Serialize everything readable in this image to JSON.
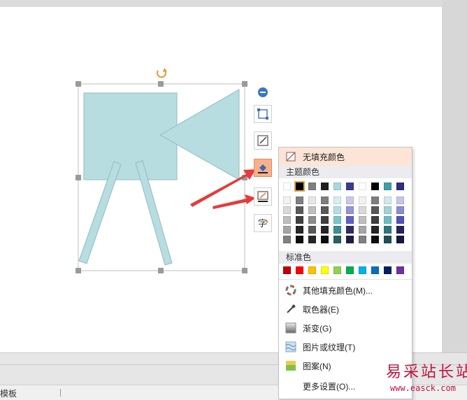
{
  "menu": {
    "no_fill": "无填充颜色",
    "theme_colors_title": "主题颜色",
    "standard_colors_title": "标准色",
    "more_fill_colors": "其他填充颜色(M)...",
    "eyedropper": "取色器(E)",
    "gradient": "渐变(G)",
    "picture_texture": "图片或纹理(T)",
    "pattern": "图案(N)",
    "more_settings": "更多设置(O)..."
  },
  "theme_colors": [
    "#ffffff",
    "#000000",
    "#7f7f7f",
    "#1f1f1f",
    "#a8d8dc",
    "#3b3c8f",
    "#ffffff",
    "#000000",
    "#3f9ea6",
    "#2e2f7e"
  ],
  "theme_shades": [
    [
      "#f2f2f2",
      "#d9d9d9",
      "#bfbfbf",
      "#a6a6a6",
      "#808080"
    ],
    [
      "#7f7f7f",
      "#595959",
      "#3f3f3f",
      "#262626",
      "#0d0d0d"
    ],
    [
      "#e6e6e6",
      "#bfbfbf",
      "#8c8c8c",
      "#595959",
      "#262626"
    ],
    [
      "#7f7f7f",
      "#595959",
      "#404040",
      "#262626",
      "#0d0d0d"
    ],
    [
      "#d6eef0",
      "#b3dfe3",
      "#7cc6cd",
      "#3e8f96",
      "#285f64"
    ],
    [
      "#c9c9ec",
      "#9596d8",
      "#5f61c4",
      "#2c2d6b",
      "#1d1e47"
    ],
    [
      "#f2f2f2",
      "#d9d9d9",
      "#bfbfbf",
      "#a6a6a6",
      "#808080"
    ],
    [
      "#7f7f7f",
      "#595959",
      "#3f3f3f",
      "#262626",
      "#0d0d0d"
    ],
    [
      "#cfe9ec",
      "#9fd3d8",
      "#6fbcc4",
      "#2f777d",
      "#1f4f53"
    ],
    [
      "#c5c6ea",
      "#8b8cd6",
      "#5152c1",
      "#22235f",
      "#17173f"
    ]
  ],
  "standard_colors": [
    "#c00000",
    "#ff0000",
    "#ffc000",
    "#ffff00",
    "#92d050",
    "#00b050",
    "#00b0f0",
    "#0070c0",
    "#002060",
    "#7030a0"
  ],
  "shape_fill": "#b7dde0",
  "status": {
    "left_text": "模板"
  },
  "watermark": {
    "cn": "易采站长站",
    "url": "www.easck.com"
  }
}
